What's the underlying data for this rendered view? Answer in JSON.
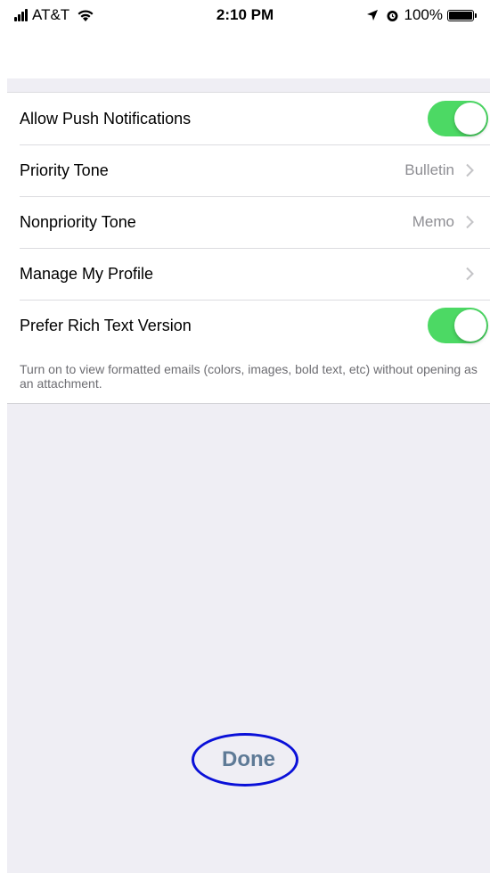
{
  "status_bar": {
    "carrier": "AT&T",
    "time": "2:10 PM",
    "battery": "100%",
    "battery_level": 1.0,
    "icons": [
      "signal-icon",
      "wifi-icon",
      "location-icon",
      "alarm-icon",
      "battery-icon"
    ]
  },
  "settings": {
    "rows": [
      {
        "label": "Allow Push Notifications",
        "type": "toggle",
        "on": true
      },
      {
        "label": "Priority Tone",
        "value": "Bulletin",
        "type": "disclosure"
      },
      {
        "label": "Nonpriority Tone",
        "value": "Memo",
        "type": "disclosure"
      },
      {
        "label": "Manage My Profile",
        "type": "disclosure"
      },
      {
        "label": "Prefer Rich Text Version",
        "type": "toggle",
        "on": true
      }
    ],
    "footnote": "Turn on to view formatted emails (colors, images, bold text, etc) without opening as an attachment."
  },
  "done_label": "Done",
  "colors": {
    "toggle_on": "#4cd964",
    "done_text": "#5e7a96",
    "annotation_circle": "#0a10d8",
    "grouped_background": "#efeef4"
  }
}
